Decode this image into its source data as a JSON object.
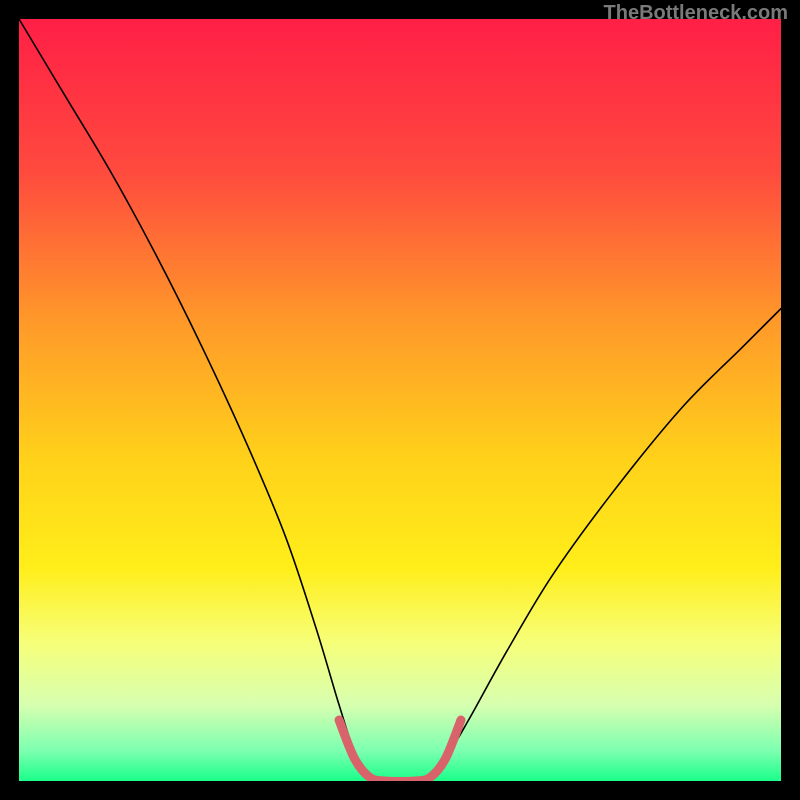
{
  "watermark": "TheBottleneck.com",
  "chart_data": {
    "type": "line",
    "title": "",
    "xlabel": "",
    "ylabel": "",
    "xlim": [
      0,
      100
    ],
    "ylim": [
      0,
      100
    ],
    "background_gradient": {
      "stops": [
        {
          "offset": 0,
          "color": "#ff1f46"
        },
        {
          "offset": 20,
          "color": "#ff4a3e"
        },
        {
          "offset": 40,
          "color": "#ff9a29"
        },
        {
          "offset": 58,
          "color": "#ffd21a"
        },
        {
          "offset": 72,
          "color": "#ffee1a"
        },
        {
          "offset": 82,
          "color": "#f6ff7a"
        },
        {
          "offset": 90,
          "color": "#d7ffb0"
        },
        {
          "offset": 96,
          "color": "#7dffb0"
        },
        {
          "offset": 100,
          "color": "#1aff8a"
        }
      ]
    },
    "series": [
      {
        "name": "bottleneck-curve",
        "color": "#000000",
        "width": 1.6,
        "points": [
          {
            "x": 0,
            "y": 100
          },
          {
            "x": 6,
            "y": 90
          },
          {
            "x": 12,
            "y": 80
          },
          {
            "x": 18,
            "y": 69
          },
          {
            "x": 24,
            "y": 57
          },
          {
            "x": 30,
            "y": 44
          },
          {
            "x": 35,
            "y": 32
          },
          {
            "x": 39,
            "y": 20
          },
          {
            "x": 42,
            "y": 10
          },
          {
            "x": 44,
            "y": 4
          },
          {
            "x": 46,
            "y": 1
          },
          {
            "x": 48,
            "y": 0
          },
          {
            "x": 52,
            "y": 0
          },
          {
            "x": 54,
            "y": 1
          },
          {
            "x": 56,
            "y": 3
          },
          {
            "x": 59,
            "y": 8
          },
          {
            "x": 64,
            "y": 17
          },
          {
            "x": 70,
            "y": 27
          },
          {
            "x": 78,
            "y": 38
          },
          {
            "x": 87,
            "y": 49
          },
          {
            "x": 95,
            "y": 57
          },
          {
            "x": 100,
            "y": 62
          }
        ]
      },
      {
        "name": "bottom-marker",
        "color": "#d9636b",
        "width": 9,
        "linecap": "round",
        "points": [
          {
            "x": 42,
            "y": 8
          },
          {
            "x": 44,
            "y": 3
          },
          {
            "x": 46,
            "y": 0.5
          },
          {
            "x": 48,
            "y": 0
          },
          {
            "x": 52,
            "y": 0
          },
          {
            "x": 54,
            "y": 0.5
          },
          {
            "x": 56,
            "y": 3
          },
          {
            "x": 58,
            "y": 8
          }
        ]
      }
    ]
  }
}
